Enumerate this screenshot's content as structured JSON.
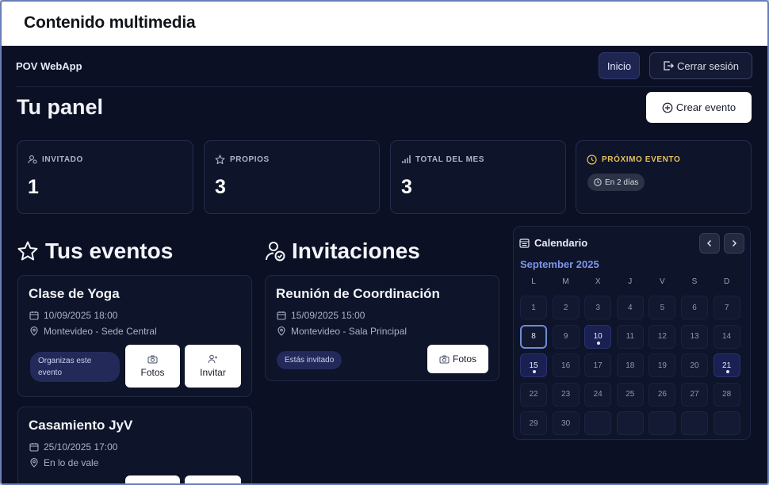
{
  "window": {
    "title": "Contenido multimedia"
  },
  "nav": {
    "brand": "POV WebApp",
    "home_label": "Inicio",
    "logout_label": "Cerrar sesión"
  },
  "header": {
    "title": "Tu panel",
    "create_label": "Crear evento"
  },
  "stats": [
    {
      "label": "INVITADO",
      "value": "1",
      "icon": "user-icon"
    },
    {
      "label": "PROPIOS",
      "value": "3",
      "icon": "star-icon"
    },
    {
      "label": "TOTAL DEL MES",
      "value": "3",
      "icon": "bar-chart-icon"
    }
  ],
  "next_event": {
    "label": "PRÓXIMO EVENTO",
    "time": "En 2 días",
    "color": "#e8c35a"
  },
  "my_events": {
    "title": "Tus eventos",
    "items": [
      {
        "name": "Clase de Yoga",
        "date": "10/09/2025 18:00",
        "location": "Montevideo - Sede Central",
        "badge": "Organizas este evento",
        "photos_label": "Fotos",
        "invite_label": "Invitar"
      },
      {
        "name": "Casamiento JyV",
        "date": "25/10/2025 17:00",
        "location": "En lo de vale"
      }
    ]
  },
  "invitations": {
    "title": "Invitaciones",
    "items": [
      {
        "name": "Reunión de Coordinación",
        "date": "15/09/2025 15:00",
        "location": "Montevideo - Sala Principal",
        "badge": "Estás invitado",
        "photos_label": "Fotos"
      }
    ]
  },
  "calendar": {
    "title": "Calendario",
    "month": "September 2025",
    "weekdays": [
      "L",
      "M",
      "X",
      "J",
      "V",
      "S",
      "D"
    ],
    "weeks": [
      [
        "1",
        "2",
        "3",
        "4",
        "5",
        "6",
        "7"
      ],
      [
        "8",
        "9",
        "10",
        "11",
        "12",
        "13",
        "14"
      ],
      [
        "15",
        "16",
        "17",
        "18",
        "19",
        "20",
        "21"
      ],
      [
        "22",
        "23",
        "24",
        "25",
        "26",
        "27",
        "28"
      ],
      [
        "29",
        "30",
        "",
        "",
        "",
        "",
        ""
      ]
    ],
    "today": "8",
    "event_days": [
      "10",
      "15",
      "21"
    ],
    "accent": "#7f95ea"
  }
}
